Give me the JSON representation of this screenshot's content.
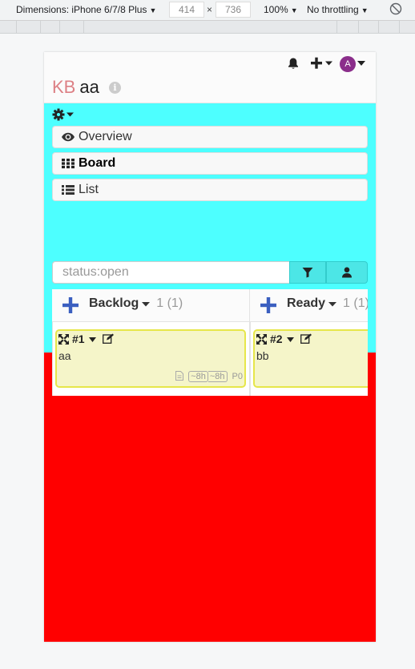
{
  "devtools": {
    "dimensions_label": "Dimensions: iPhone 6/7/8 Plus",
    "width": "414",
    "times": "×",
    "height": "736",
    "zoom": "100%",
    "throttling": "No throttling"
  },
  "header": {
    "logo": "KB",
    "project_name": "aa",
    "info_icon": "i",
    "avatar_letter": "A"
  },
  "nav": {
    "overview": "Overview",
    "board": "Board",
    "list": "List"
  },
  "search": {
    "placeholder": "status:open"
  },
  "columns": [
    {
      "title": "Backlog",
      "count": "1 (1)",
      "task": {
        "id": "#1",
        "title": "aa",
        "estimate_a": "~8h",
        "estimate_b": "~8h",
        "priority": "P0"
      }
    },
    {
      "title": "Ready",
      "count": "1 (1)",
      "task": {
        "id": "#2",
        "title": "bb"
      }
    }
  ],
  "colors": {
    "project_bg": "#4dffff",
    "page_bg": "#ff0000",
    "task_bg": "#f5f5c9",
    "task_border": "#e6e64a",
    "logo_accent": "#dd8085",
    "avatar": "#8b2e8b",
    "add_icon": "#3b5fc0"
  },
  "icons": [
    "bell-icon",
    "plus-icon",
    "chevron-down-icon",
    "info-icon",
    "gear-icon",
    "eye-icon",
    "grid-icon",
    "list-icon",
    "filter-icon",
    "user-icon",
    "expand-icon",
    "edit-icon",
    "document-icon",
    "rotate-icon"
  ]
}
